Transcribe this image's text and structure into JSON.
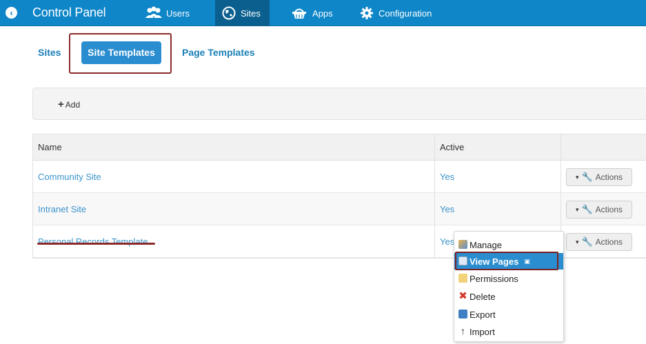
{
  "header": {
    "title": "Control Panel",
    "nav": [
      {
        "label": "Users",
        "icon": "users-icon",
        "active": false
      },
      {
        "label": "Sites",
        "icon": "globe-icon",
        "active": true
      },
      {
        "label": "Apps",
        "icon": "basket-icon",
        "active": false
      },
      {
        "label": "Configuration",
        "icon": "gear-icon",
        "active": false
      }
    ]
  },
  "subtabs": {
    "sites": "Sites",
    "site_templates": "Site Templates",
    "page_templates": "Page Templates"
  },
  "toolbar": {
    "add_label": "Add"
  },
  "table": {
    "columns": [
      "Name",
      "Active",
      ""
    ],
    "rows": [
      {
        "name": "Community Site",
        "active": "Yes",
        "action": "Actions"
      },
      {
        "name": "Intranet Site",
        "active": "Yes",
        "action": "Actions"
      },
      {
        "name": "Personal Records Template",
        "active": "Yes",
        "action": "Actions"
      }
    ]
  },
  "menu": {
    "items": [
      {
        "label": "Manage",
        "icon": "manage-icon"
      },
      {
        "label": "View Pages",
        "icon": "view-pages-icon",
        "selected": true
      },
      {
        "label": "Permissions",
        "icon": "permissions-icon"
      },
      {
        "label": "Delete",
        "icon": "delete-icon"
      },
      {
        "label": "Export",
        "icon": "export-icon"
      },
      {
        "label": "Import",
        "icon": "import-icon"
      }
    ]
  },
  "colors": {
    "topbar": "#0e86c8",
    "accent": "#2a8dd0",
    "link": "#3a93c9",
    "annotation": "#8b2a2a"
  }
}
